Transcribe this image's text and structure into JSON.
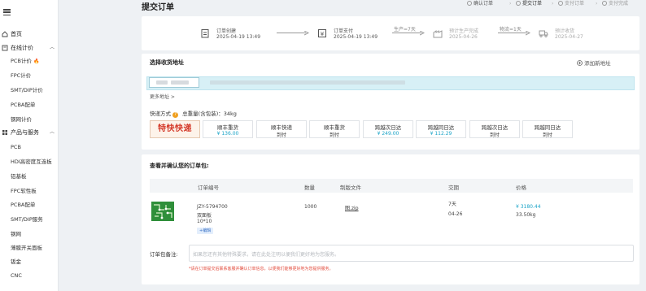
{
  "sidebar": {
    "groups": [
      {
        "label": "首页",
        "icon": "home-icon"
      },
      {
        "label": "在线计价",
        "icon": "calculator-icon",
        "items": [
          "PCB计价",
          "FPC计价",
          "SMT/DIP计价",
          "PCBA配单",
          "钢网计价"
        ]
      },
      {
        "label": "产品与服务",
        "icon": "grid-icon",
        "items": [
          "PCB",
          "HDI高密度互连板",
          "铝基板",
          "FPC软性板",
          "PCBA配单",
          "SMT/DIP服务",
          "钢网",
          "薄膜开关面板",
          "钣金",
          "CNC"
        ]
      }
    ]
  },
  "page": {
    "title": "提交订单",
    "steps": [
      "确认订单",
      "提交订单",
      "支付订单",
      "支付完成"
    ]
  },
  "progress": {
    "nodes": [
      {
        "title": "订单创建",
        "date": "2025-04-19 13:49"
      },
      {
        "title": "订单支付",
        "date": "2025-04-19 13:49"
      },
      {
        "title": "预计生产完成",
        "date": "2025-04-26"
      },
      {
        "title": "预计收货",
        "date": "2025-04-27"
      }
    ],
    "arrows": [
      "",
      "生产=7天",
      "物流=1天"
    ]
  },
  "address": {
    "title": "选择收货地址",
    "add_label": "添加新地址",
    "more_label": "更多地址 >"
  },
  "shipping": {
    "label": "快递方式",
    "help": "?",
    "weight": "总重量(含包装)：34kg",
    "logo": "特快快递",
    "options": [
      {
        "name": "顺丰重货",
        "price": "¥ 136.00"
      },
      {
        "name": "顺丰快递",
        "price": "到付"
      },
      {
        "name": "顺丰重货",
        "price": "到付"
      },
      {
        "name": "跨越次日达",
        "price": "¥ 249.00"
      },
      {
        "name": "跨越同日达",
        "price": "¥ 112.29"
      },
      {
        "name": "跨越次日达",
        "price": "到付"
      },
      {
        "name": "跨越同日达",
        "price": "到付"
      }
    ]
  },
  "order": {
    "title": "查看并确认您的订单包:",
    "headers": [
      "订单编号",
      "数量",
      "制版文件",
      "交期",
      "价格"
    ],
    "row": {
      "order_no": "JZY-5794700",
      "board_type": "双面板",
      "size": "10*10",
      "tag": "+编辑",
      "qty": "1000",
      "file": "图.zip",
      "lead_days": "7天",
      "lead_date": "04-26",
      "price": "¥ 3180.44",
      "weight": "33.50kg"
    },
    "remark_label": "订单包备注:",
    "remark_placeholder": "如果您还有其他特殊要求，请在此处注明以便我们更好地为您服务。",
    "remark_note": "*请在订单提交后联系客服并确认订单信息，以便我们能够更好地为您提供服务。"
  }
}
